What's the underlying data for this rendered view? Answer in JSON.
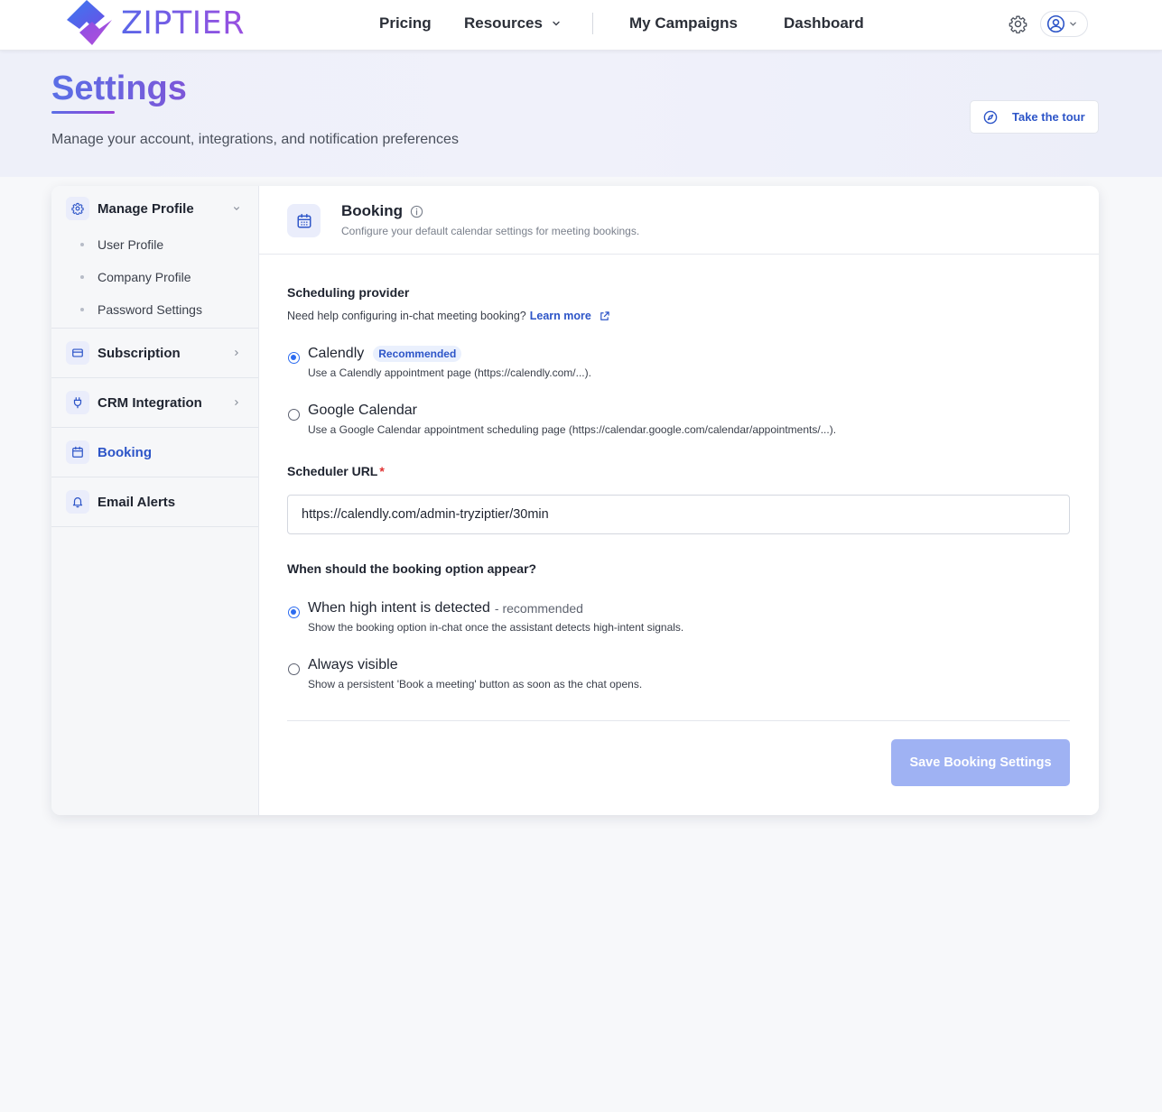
{
  "brand": {
    "name": "ZIPTIER"
  },
  "topnav": {
    "pricing": "Pricing",
    "resources": "Resources",
    "my_campaigns": "My Campaigns",
    "dashboard": "Dashboard"
  },
  "header": {
    "title": "Settings",
    "subtitle": "Manage your account, integrations, and notification preferences",
    "tour_button": "Take the tour"
  },
  "sidebar": {
    "manage_profile": {
      "label": "Manage Profile",
      "icon": "gear-icon",
      "items": [
        "User Profile",
        "Company Profile",
        "Password Settings"
      ]
    },
    "subscription": {
      "label": "Subscription",
      "icon": "credit-card-icon"
    },
    "crm": {
      "label": "CRM Integration",
      "icon": "plug-icon"
    },
    "booking": {
      "label": "Booking",
      "icon": "calendar-icon",
      "active": true
    },
    "email_alerts": {
      "label": "Email Alerts",
      "icon": "bell-icon"
    }
  },
  "content": {
    "title": "Booking",
    "subtitle": "Configure your default calendar settings for meeting bookings.",
    "provider": {
      "label": "Scheduling provider",
      "help": "Need help configuring in-chat meeting booking?",
      "help_link": "Learn more",
      "options": [
        {
          "title": "Calendly",
          "badge": "Recommended",
          "desc": "Use a Calendly appointment page (https://calendly.com/...).",
          "checked": true
        },
        {
          "title": "Google Calendar",
          "desc": "Use a Google Calendar appointment scheduling page (https://calendar.google.com/calendar/appointments/...).",
          "checked": false
        }
      ]
    },
    "scheduler_url": {
      "label": "Scheduler URL",
      "required_mark": "*",
      "value": "https://calendly.com/admin-tryziptier/30min"
    },
    "appear": {
      "label": "When should the booking option appear?",
      "options": [
        {
          "title": "When high intent is detected",
          "suffix": "- recommended",
          "desc": "Show the booking option in-chat once the assistant detects high-intent signals.",
          "checked": true
        },
        {
          "title": "Always visible",
          "desc": "Show a persistent 'Book a meeting' button as soon as the chat opens.",
          "checked": false
        }
      ]
    },
    "save_button": "Save Booking Settings"
  },
  "colors": {
    "accent": "#2d55c8",
    "radio": "#2d6cf0",
    "save_disabled": "#9fb2f3",
    "required": "#e03131"
  }
}
